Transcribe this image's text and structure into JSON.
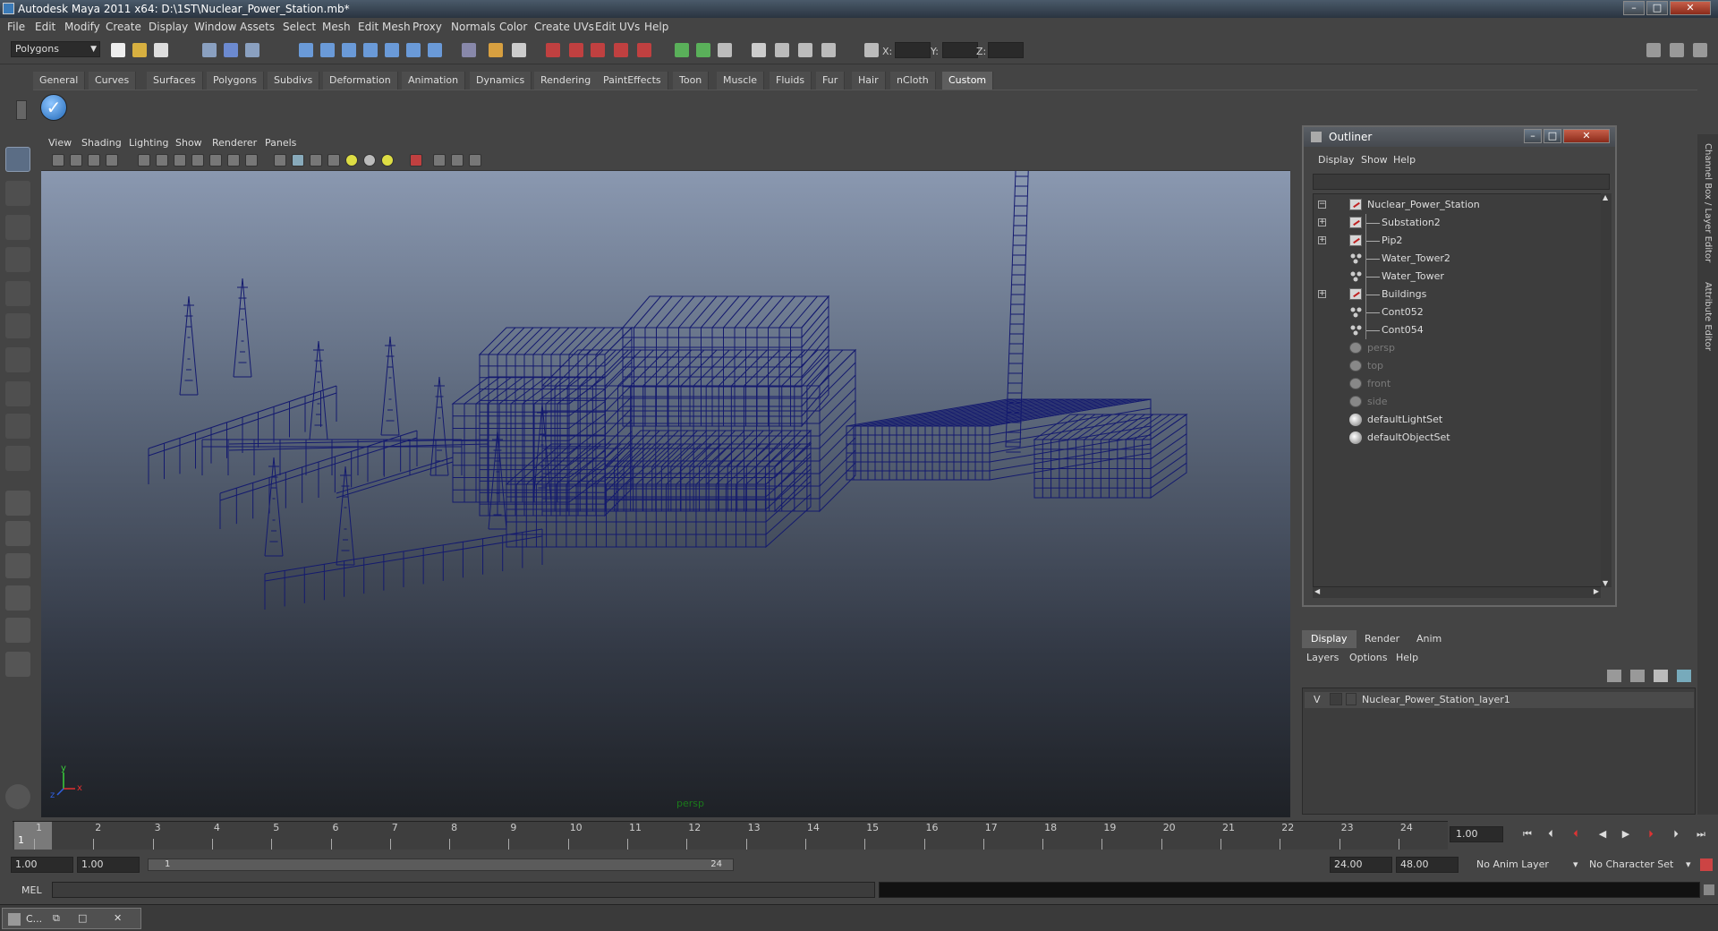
{
  "window": {
    "title": "Autodesk Maya 2011 x64: D:\\1ST\\Nuclear_Power_Station.mb*"
  },
  "menubar": [
    "File",
    "Edit",
    "Modify",
    "Create",
    "Display",
    "Window",
    "Assets",
    "Select",
    "Mesh",
    "Edit Mesh",
    "Proxy",
    "Normals",
    "Color",
    "Create UVs",
    "Edit UVs",
    "Help"
  ],
  "statusline": {
    "mode": "Polygons",
    "x_label": "X:",
    "y_label": "Y:",
    "z_label": "Z:"
  },
  "shelf": {
    "tabs": [
      "General",
      "Curves",
      "Surfaces",
      "Polygons",
      "Subdivs",
      "Deformation",
      "Animation",
      "Dynamics",
      "Rendering",
      "PaintEffects",
      "Toon",
      "Muscle",
      "Fluids",
      "Fur",
      "Hair",
      "nCloth",
      "Custom"
    ],
    "active_tab": "Custom",
    "custom_icon": "✓"
  },
  "viewport": {
    "menu": [
      "View",
      "Shading",
      "Lighting",
      "Show",
      "Renderer",
      "Panels"
    ],
    "camera": "persp",
    "axis_x": "x",
    "axis_y": "y",
    "axis_z": "z",
    "wire_color": "#141a6e"
  },
  "outliner": {
    "title": "Outliner",
    "menu": [
      "Display",
      "Show",
      "Help"
    ],
    "items": [
      {
        "label": "Nuclear_Power_Station",
        "type": "mesh",
        "expander": "−",
        "indent": 0
      },
      {
        "label": "Substation2",
        "type": "mesh",
        "expander": "+",
        "indent": 1
      },
      {
        "label": "Pip2",
        "type": "mesh",
        "expander": "+",
        "indent": 1
      },
      {
        "label": "Water_Tower2",
        "type": "group",
        "expander": "",
        "indent": 1
      },
      {
        "label": "Water_Tower",
        "type": "group",
        "expander": "",
        "indent": 1
      },
      {
        "label": "Buildings",
        "type": "mesh",
        "expander": "+",
        "indent": 1
      },
      {
        "label": "Cont052",
        "type": "group",
        "expander": "",
        "indent": 1
      },
      {
        "label": "Cont054",
        "type": "group",
        "expander": "",
        "indent": 1
      },
      {
        "label": "persp",
        "type": "camera",
        "expander": "",
        "indent": 0
      },
      {
        "label": "top",
        "type": "camera",
        "expander": "",
        "indent": 0
      },
      {
        "label": "front",
        "type": "camera",
        "expander": "",
        "indent": 0
      },
      {
        "label": "side",
        "type": "camera",
        "expander": "",
        "indent": 0
      },
      {
        "label": "defaultLightSet",
        "type": "set",
        "expander": "",
        "indent": 0
      },
      {
        "label": "defaultObjectSet",
        "type": "set",
        "expander": "",
        "indent": 0
      }
    ]
  },
  "layer_editor": {
    "tabs": [
      "Display",
      "Render",
      "Anim"
    ],
    "active_tab": "Display",
    "menu": [
      "Layers",
      "Options",
      "Help"
    ],
    "layer": {
      "visible": "V",
      "name": "Nuclear_Power_Station_layer1"
    }
  },
  "side_strip": {
    "channel_box": "Channel Box / Layer Editor",
    "attribute_editor": "Attribute Editor"
  },
  "timeslider": {
    "frames": [
      "1",
      "2",
      "3",
      "4",
      "5",
      "6",
      "7",
      "8",
      "9",
      "10",
      "11",
      "12",
      "13",
      "14",
      "15",
      "16",
      "17",
      "18",
      "19",
      "20",
      "21",
      "22",
      "23",
      "24"
    ],
    "current_frame_label": "1",
    "current_frame": "1.00"
  },
  "range": {
    "start": "1.00",
    "playback_start": "1.00",
    "slider_start": "1",
    "slider_end": "24",
    "playback_end": "24.00",
    "end": "48.00",
    "anim_layer": "No Anim Layer",
    "character_set": "No Character Set"
  },
  "cmdline": {
    "label": "MEL"
  },
  "taskbar": {
    "item": "C..."
  }
}
